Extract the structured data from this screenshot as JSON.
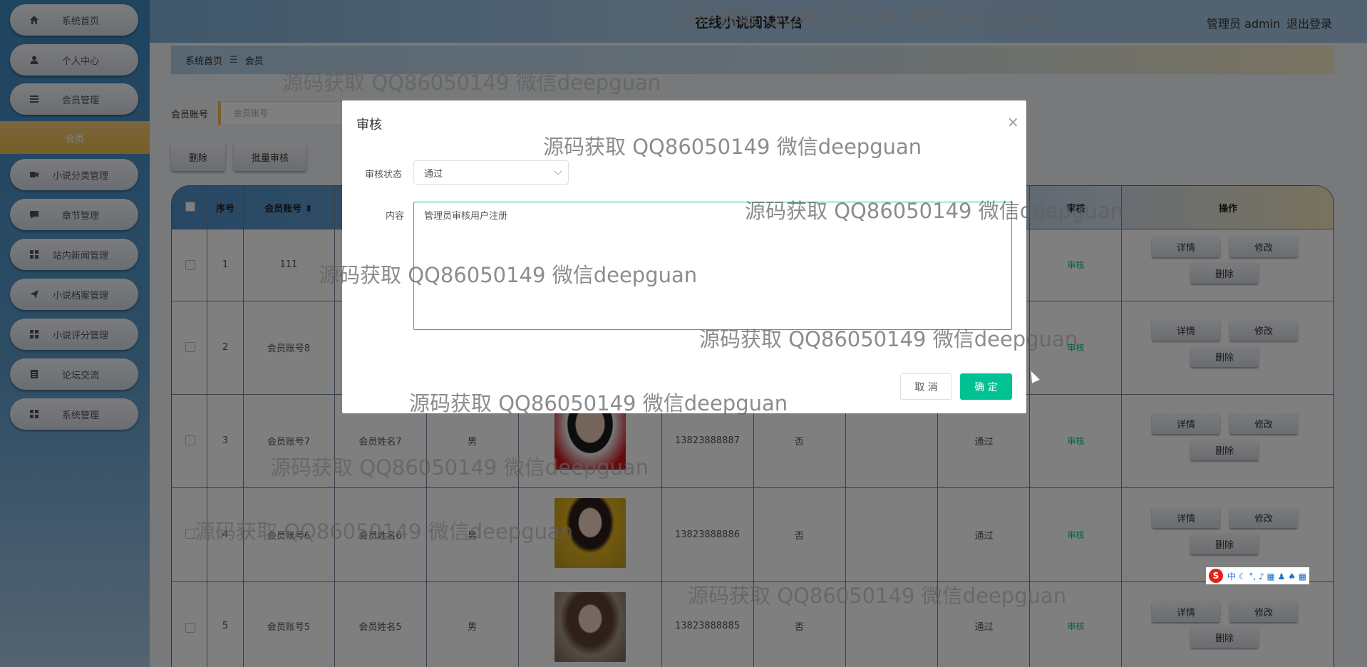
{
  "topbar": {
    "site_title": "在线小说阅读平台",
    "admin_label": "管理员 admin",
    "logout_label": "退出登录"
  },
  "sidebar": {
    "items": [
      {
        "label": "系统首页",
        "icon": "home-icon"
      },
      {
        "label": "个人中心",
        "icon": "user-icon"
      },
      {
        "label": "会员管理",
        "icon": "menu-icon"
      },
      {
        "label": "小说分类管理",
        "icon": "video-icon"
      },
      {
        "label": "章节管理",
        "icon": "comment-icon"
      },
      {
        "label": "站内新闻管理",
        "icon": "grid-icon"
      },
      {
        "label": "小说档案管理",
        "icon": "send-icon"
      },
      {
        "label": "小说评分管理",
        "icon": "grid-icon"
      },
      {
        "label": "论坛交流",
        "icon": "document-icon"
      },
      {
        "label": "系统管理",
        "icon": "grid-icon"
      }
    ],
    "sub_item": "会员"
  },
  "breadcrumb": {
    "home": "系统首页",
    "separator": "☰",
    "current": "会员"
  },
  "search": {
    "label": "会员账号",
    "placeholder": "会员账号"
  },
  "toolbar": {
    "delete_label": "删除",
    "batch_review_label": "批量审核"
  },
  "table": {
    "headers": {
      "index": "序号",
      "account": "会员账号 ⬍",
      "review": "审核",
      "actions": "操作"
    },
    "rows": [
      {
        "index": "1",
        "account": "111",
        "name": "",
        "gender": "",
        "phone": "",
        "vip": "",
        "status": "",
        "review": "审核"
      },
      {
        "index": "2",
        "account": "会员账号8",
        "name": "",
        "gender": "",
        "phone": "",
        "vip": "",
        "status": "",
        "review": "审核"
      },
      {
        "index": "3",
        "account": "会员账号7",
        "name": "会员姓名7",
        "gender": "男",
        "phone": "13823888887",
        "vip": "否",
        "status": "通过",
        "review": "审核"
      },
      {
        "index": "4",
        "account": "会员账号6",
        "name": "会员姓名6",
        "gender": "男",
        "phone": "13823888886",
        "vip": "否",
        "status": "通过",
        "review": "审核"
      },
      {
        "index": "5",
        "account": "会员账号5",
        "name": "会员姓名5",
        "gender": "男",
        "phone": "13823888885",
        "vip": "否",
        "status": "通过",
        "review": "审核"
      }
    ],
    "action_labels": {
      "detail": "详情",
      "edit": "修改",
      "delete": "删除"
    }
  },
  "dialog": {
    "title": "审核",
    "close": "×",
    "status_label": "审核状态",
    "status_value": "通过",
    "content_label": "内容",
    "content_value": "管理员审核用户注册",
    "cancel_label": "取 消",
    "ok_label": "确 定"
  },
  "watermark": "源码获取 QQ86050149 微信deepguan",
  "ime_bar": {
    "logo": "S",
    "text": "中 ☾ °, ♪ ▦ ♟ ♠ ▦"
  },
  "colors": {
    "accent": "#00c292",
    "nav_active": "#f1bb52",
    "sidebar_top": "#3d88c0"
  }
}
